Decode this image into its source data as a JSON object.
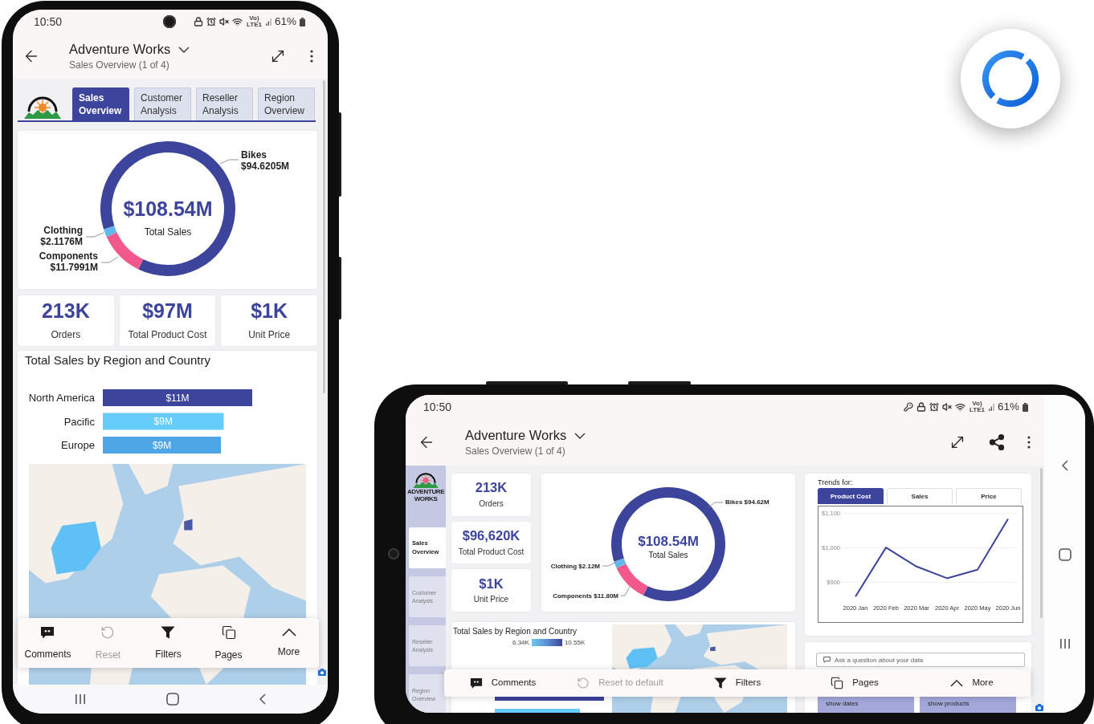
{
  "portrait_phone": {
    "status_bar": {
      "time": "10:50",
      "network": "Vo) LTE1",
      "battery": "61%"
    },
    "header": {
      "title": "Adventure Works",
      "subtitle": "Sales Overview (1 of 4)"
    },
    "tabs": [
      {
        "label": "Sales Overview",
        "selected": true
      },
      {
        "label": "Customer Analysis",
        "selected": false
      },
      {
        "label": "Reseller Analysis",
        "selected": false
      },
      {
        "label": "Region Overview",
        "selected": false
      }
    ],
    "sales_donut": {
      "center_value": "$108.54M",
      "center_label": "Total Sales",
      "chart_data": {
        "type": "donut",
        "categories": [
          "Bikes",
          "Clothing",
          "Components"
        ],
        "values": [
          94.6205,
          2.1176,
          11.7991
        ],
        "value_labels": [
          "$94.6205M",
          "$2.1176M",
          "$11.7991M"
        ],
        "colors": [
          "#3d449c",
          "#62b8ec",
          "#f2588b"
        ]
      }
    },
    "kpis": [
      {
        "value": "213K",
        "label": "Orders"
      },
      {
        "value": "$97M",
        "label": "Total Product Cost"
      },
      {
        "value": "$1K",
        "label": "Unit Price"
      }
    ],
    "region_sales": {
      "title": "Total Sales by Region and Country",
      "chart_data": {
        "type": "bar",
        "orientation": "horizontal",
        "categories": [
          "North America",
          "Pacific",
          "Europe"
        ],
        "values": [
          11,
          8.9,
          8.7
        ],
        "value_labels": [
          "$11M",
          "$9M",
          "$9M"
        ],
        "colors": [
          "#3d449c",
          "#66cdfb",
          "#4ea6e6"
        ]
      }
    },
    "action_bar": [
      {
        "kind": "comments",
        "label": "Comments",
        "disabled": false
      },
      {
        "kind": "reset",
        "label": "Reset",
        "disabled": true
      },
      {
        "kind": "filters",
        "label": "Filters",
        "disabled": false
      },
      {
        "kind": "pages",
        "label": "Pages",
        "disabled": false
      },
      {
        "kind": "more",
        "label": "More",
        "disabled": false
      }
    ]
  },
  "landscape_phone": {
    "status_bar": {
      "time": "10:50",
      "network": "Vo) LTE1",
      "battery": "61%"
    },
    "header": {
      "title": "Adventure Works",
      "subtitle": "Sales Overview (1 of 4)"
    },
    "logo_text": "ADVENTURE WORKS",
    "tabs": [
      {
        "label": "Sales Overview",
        "selected": true
      },
      {
        "label": "Customer Analysis",
        "selected": false
      },
      {
        "label": "Reseller Analysis",
        "selected": false
      },
      {
        "label": "Region Overview",
        "selected": false
      }
    ],
    "kpis": [
      {
        "value": "213K",
        "label": "Orders"
      },
      {
        "value": "$96,620K",
        "label": "Total Product Cost"
      },
      {
        "value": "$1K",
        "label": "Unit Price"
      }
    ],
    "sales_donut": {
      "center_value": "$108.54M",
      "center_label": "Total Sales",
      "chart_data": {
        "type": "donut",
        "categories": [
          "Bikes",
          "Clothing",
          "Components"
        ],
        "values": [
          94.62,
          2.12,
          11.8
        ],
        "value_labels": [
          "$94.62M",
          "$2.12M",
          "$11.80M"
        ],
        "colors": [
          "#3d449c",
          "#62b8ec",
          "#f2588b"
        ]
      }
    },
    "trends": {
      "title": "Trends for:",
      "tabs": [
        {
          "label": "Product Cost",
          "selected": true
        },
        {
          "label": "Sales",
          "selected": false
        },
        {
          "label": "Price",
          "selected": false
        }
      ],
      "chart_data": {
        "type": "line",
        "categories": [
          "2020 Jan",
          "2020 Feb",
          "2020 Mar",
          "2020 Apr",
          "2020 May",
          "2020 Jun"
        ],
        "series": [
          {
            "color": "#3d449c",
            "values": [
              859,
              1001,
              946,
              912,
              937,
              1084
            ]
          }
        ],
        "grid": true,
        "ylim": [
          784,
          1121
        ],
        "yticks": [
          {
            "value": 900,
            "label": "$900"
          },
          {
            "value": 1000,
            "label": "$1,000"
          },
          {
            "value": 1100,
            "label": "$1,100"
          }
        ]
      }
    },
    "region_sales": {
      "title": "Total Sales by Region and Country",
      "legend_min": "6.34K",
      "legend_max": "10.55K"
    },
    "qna": {
      "placeholder": "Ask a question about your data"
    },
    "quick_buttons": [
      "show dates",
      "show products"
    ],
    "action_bar": [
      {
        "kind": "comments",
        "label": "Comments",
        "disabled": false
      },
      {
        "kind": "reset",
        "label": "Reset to default",
        "disabled": true
      },
      {
        "kind": "filters",
        "label": "Filters",
        "disabled": false
      },
      {
        "kind": "pages",
        "label": "Pages",
        "disabled": false
      },
      {
        "kind": "more",
        "label": "More",
        "disabled": false
      }
    ]
  }
}
